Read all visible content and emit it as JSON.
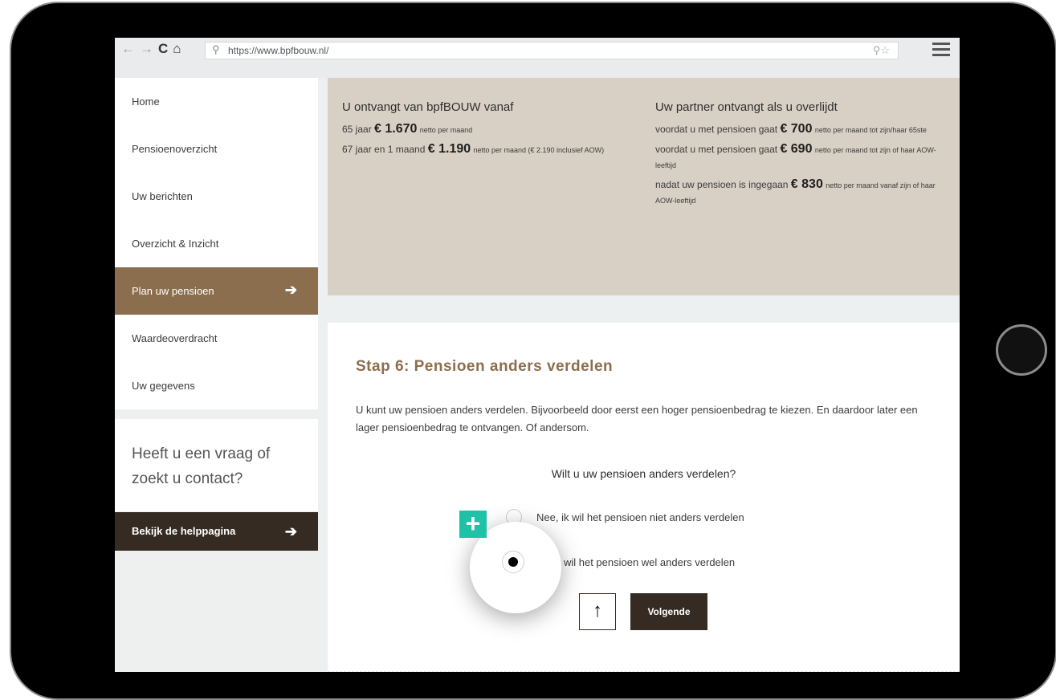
{
  "browser": {
    "url": "https://www.bpfbouw.nl/",
    "icons": [
      "back-arrow-icon",
      "forward-arrow-icon",
      "reload-icon",
      "home-icon",
      "search-icon",
      "zoom-icon",
      "star-icon",
      "menu-icon"
    ]
  },
  "sidebar": {
    "items": [
      {
        "label": "Home"
      },
      {
        "label": "Pensioenoverzicht"
      },
      {
        "label": "Uw berichten"
      },
      {
        "label": "Overzicht & Inzicht"
      },
      {
        "label": "Plan uw pensioen",
        "active": true
      },
      {
        "label": "Waardeoverdracht"
      },
      {
        "label": "Uw gegevens"
      }
    ],
    "help_text": "Heeft u een vraag of zoekt u contact?",
    "help_button": "Bekijk de helppagina"
  },
  "summary": {
    "left": {
      "title": "U ontvangt van bpfBOUW vanaf",
      "line1_pre": "65 jaar ",
      "line1_amount": "€ 1.670",
      "line1_post": "netto per maand",
      "line2_pre": "67 jaar en 1 maand ",
      "line2_amount": "€ 1.190",
      "line2_post": "netto per maand (€ 2.190 inclusief AOW)"
    },
    "right": {
      "title": "Uw partner ontvangt als u overlijdt",
      "line1_pre": "voordat u met pensioen gaat ",
      "line1_amount": "€ 700",
      "line1_post": "netto per maand tot zijn/haar 65ste",
      "line2_pre": "voordat u met pensioen gaat ",
      "line2_amount": "€ 690",
      "line2_post": "netto per maand tot zijn of haar AOW-leeftijd",
      "line3_pre": "nadat uw pensioen is ingegaan ",
      "line3_amount": "€ 830",
      "line3_post": "netto per maand vanaf zijn of haar AOW-leeftijd"
    }
  },
  "step": {
    "title": "Stap 6: Pensioen anders verdelen",
    "description": "U kunt uw pensioen anders verdelen. Bijvoorbeeld door eerst een hoger pensioenbedrag te kiezen. En daardoor later een lager pensioenbedrag te ontvangen. Of andersom.",
    "question": "Wilt u uw pensioen anders verdelen?",
    "options": [
      {
        "label": "Nee, ik wil het pensioen niet anders verdelen",
        "checked": false
      },
      {
        "label": "Ja, ik wil het pensioen wel anders verdelen",
        "checked": true
      }
    ],
    "next_button": "Volgende",
    "up_icon": "arrow-up-icon"
  },
  "overlay": {
    "badge": "+",
    "accent": "#1ec2a7"
  },
  "colors": {
    "brand_brown": "#8b6e4e",
    "dark_brown": "#352b22",
    "summary_bg": "#d9d0c5"
  }
}
